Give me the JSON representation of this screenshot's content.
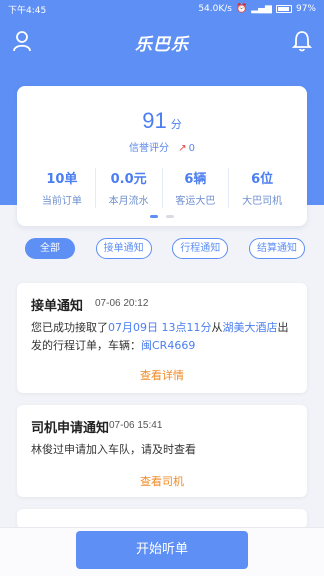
{
  "status": {
    "time": "下午4:45",
    "speed": "54.0K/s",
    "battery": "97%"
  },
  "header": {
    "logo": "乐巴乐"
  },
  "score": {
    "value": "91",
    "unit": "分",
    "label": "信誉评分",
    "trend": "0"
  },
  "stats": [
    {
      "value": "10单",
      "label": "当前订单"
    },
    {
      "value": "0.0元",
      "label": "本月流水"
    },
    {
      "value": "6辆",
      "label": "客运大巴"
    },
    {
      "value": "6位",
      "label": "大巴司机"
    }
  ],
  "filters": [
    "全部",
    "接单通知",
    "行程通知",
    "结算通知"
  ],
  "notifications": [
    {
      "title": "接单通知",
      "time": "07-06 20:12",
      "text1": "您已成功接取了",
      "date": "07月09日 13点11分",
      "text2": "从",
      "place": "湖美大酒店",
      "text3": "出发的行程订单，车辆：",
      "plate": "闽CR4669",
      "action": "查看详情"
    },
    {
      "title": "司机申请通知",
      "time": "07-06 15:41",
      "body": "林俊过申请加入车队，请及时查看",
      "action": "查看司机"
    }
  ],
  "start_button": "开始听单",
  "colors": {
    "primary": "#5e8ff4",
    "action": "#f08a24",
    "background": "#f1f3f8"
  }
}
